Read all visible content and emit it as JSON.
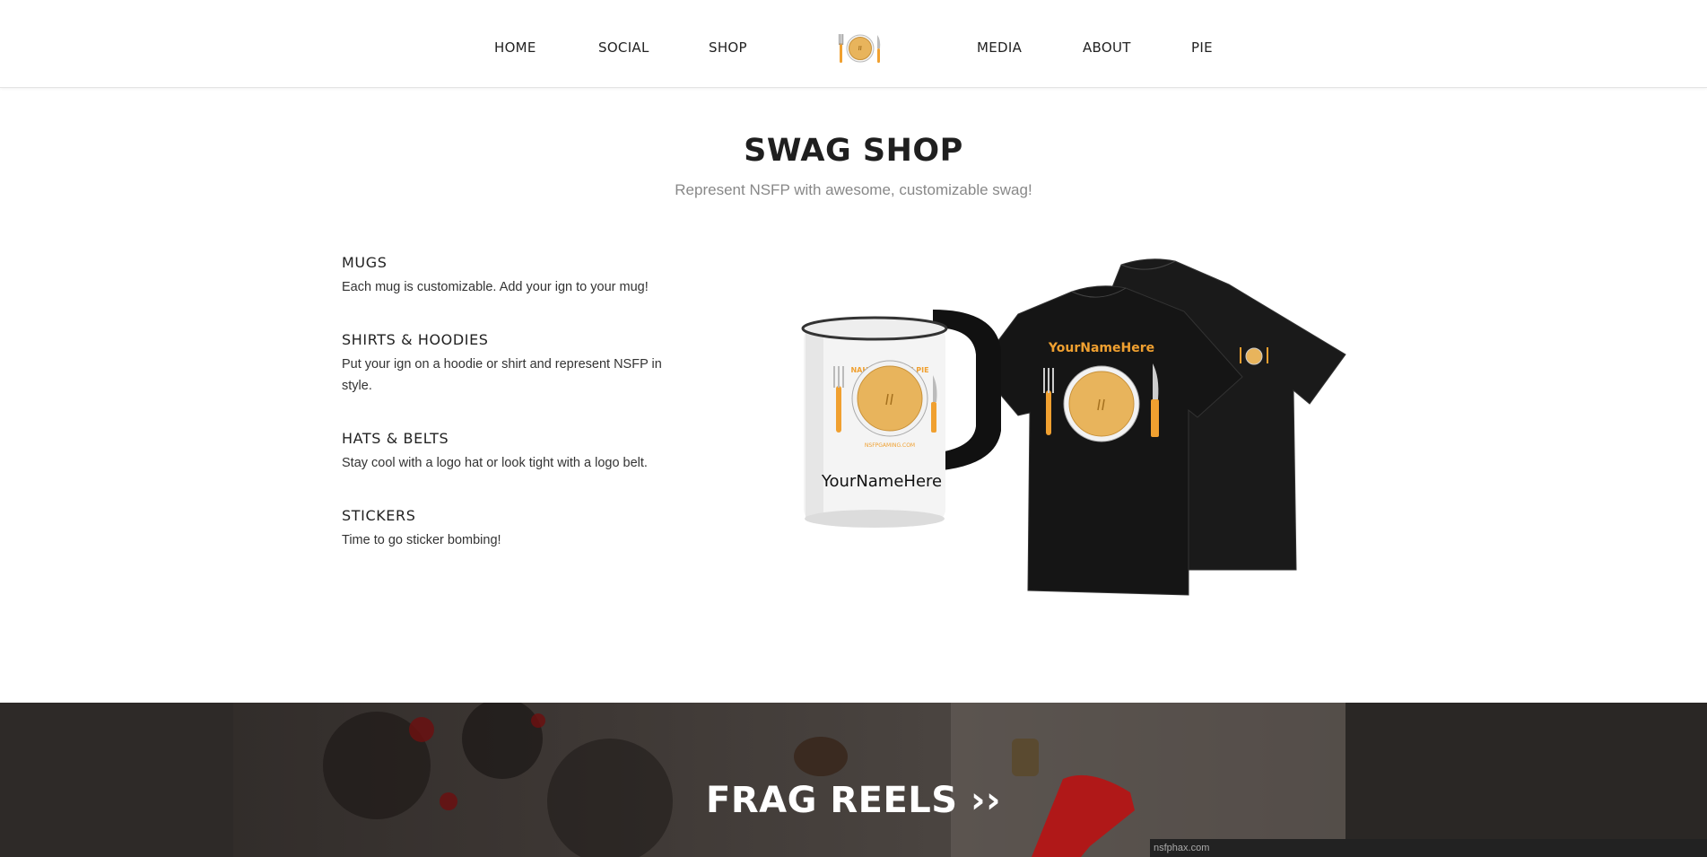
{
  "nav": {
    "items": [
      {
        "label": "HOME"
      },
      {
        "label": "SOCIAL"
      },
      {
        "label": "SHOP"
      },
      {
        "label": "MEDIA"
      },
      {
        "label": "ABOUT"
      },
      {
        "label": "PIE"
      }
    ],
    "logo_icon": "pie-plate-logo-icon"
  },
  "section": {
    "title": "SWAG SHOP",
    "subtitle": "Represent NSFP with awesome, customizable swag!"
  },
  "features": [
    {
      "title": "MUGS",
      "text": "Each mug is customizable. Add your ign to your mug!"
    },
    {
      "title": "SHIRTS & HOODIES",
      "text": "Put your ign on a hoodie or shirt and represent NSFP in style."
    },
    {
      "title": "HATS & BELTS",
      "text": "Stay cool with a logo hat or look tight with a logo belt."
    },
    {
      "title": "STICKERS",
      "text": "Time to go sticker bombing!"
    }
  ],
  "products": {
    "mug_slogan": "NAH SON, FREE PIE",
    "mug_name": "YourNameHere",
    "mug_url": "NSFPGAMING.COM",
    "shirt_name": "YourNameHere"
  },
  "banner": {
    "label": "FRAG REELS ››"
  },
  "status_bar": {
    "url": "nsfphax.com"
  },
  "colors": {
    "accent": "#f0a030",
    "pie": "#e8b45c",
    "banner_bg": "#3b3532"
  }
}
